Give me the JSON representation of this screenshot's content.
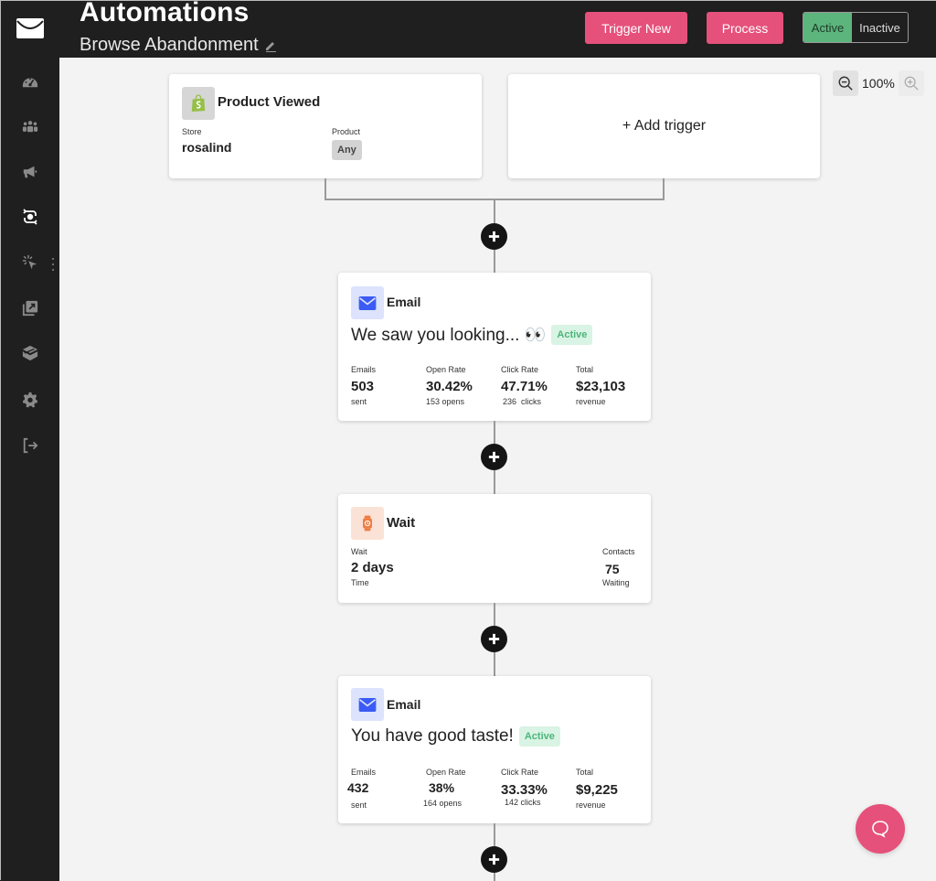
{
  "header": {
    "title": "Automations",
    "subtitle": "Browse Abandonment",
    "trigger_new_label": "Trigger New",
    "process_label": "Process",
    "status_toggle": {
      "options": [
        "Active",
        "Inactive"
      ],
      "selected": "Active"
    }
  },
  "colors": {
    "accent": "#e5517b",
    "active_green": "#5cb57c",
    "badge_green": "#4cb57a",
    "email_icon_bg": "#dde3fd",
    "email_icon": "#3b5bf5",
    "wait_icon_bg": "#fbe2d6",
    "wait_icon": "#ef7d43",
    "shopify_green": "#95bf47"
  },
  "sidebar": {
    "items": [
      {
        "icon": "dashboard-icon",
        "label": "Dashboard"
      },
      {
        "icon": "contacts-icon",
        "label": "Contacts"
      },
      {
        "icon": "campaigns-icon",
        "label": "Campaigns"
      },
      {
        "icon": "automations-icon",
        "label": "Automations",
        "active": true
      },
      {
        "icon": "click-icon",
        "label": "Tracking"
      },
      {
        "icon": "media-icon",
        "label": "Media"
      },
      {
        "icon": "layers-icon",
        "label": "Templates"
      },
      {
        "icon": "settings-icon",
        "label": "Settings"
      },
      {
        "icon": "logout-icon",
        "label": "Logout"
      }
    ]
  },
  "zoom": {
    "level": "100%"
  },
  "triggers": [
    {
      "title": "Product Viewed",
      "icon": "shopify-icon",
      "store_label": "Store",
      "store_value": "rosalind",
      "product_label": "Product",
      "product_value": "Any"
    }
  ],
  "add_trigger_label": "+ Add trigger",
  "steps": [
    {
      "type": "Email",
      "subject": "We saw you looking... 👀",
      "status": "Active",
      "stats": [
        {
          "label": "Emails",
          "value": "503",
          "sub": "sent"
        },
        {
          "label": "Open Rate",
          "value": "30.42%",
          "sub": "153 opens"
        },
        {
          "label": "Click Rate",
          "value": "47.71%",
          "sub": "236  clicks"
        },
        {
          "label": "Total",
          "value": "$23,103",
          "sub": "revenue"
        }
      ]
    },
    {
      "type": "Wait",
      "wait_label": "Wait",
      "wait_value": "2 days",
      "wait_sub": "Time",
      "contacts_label": "Contacts",
      "contacts_value": "75",
      "contacts_sub": "Waiting"
    },
    {
      "type": "Email",
      "subject": "You have good taste!",
      "status": "Active",
      "stats": [
        {
          "label": "Emails",
          "value": "432",
          "sub": "sent"
        },
        {
          "label": "Open Rate",
          "value": "38%",
          "sub": "164 opens"
        },
        {
          "label": "Click Rate",
          "value": "33.33%",
          "sub": "142 clicks"
        },
        {
          "label": "Total",
          "value": "$9,225",
          "sub": "revenue"
        }
      ]
    }
  ]
}
